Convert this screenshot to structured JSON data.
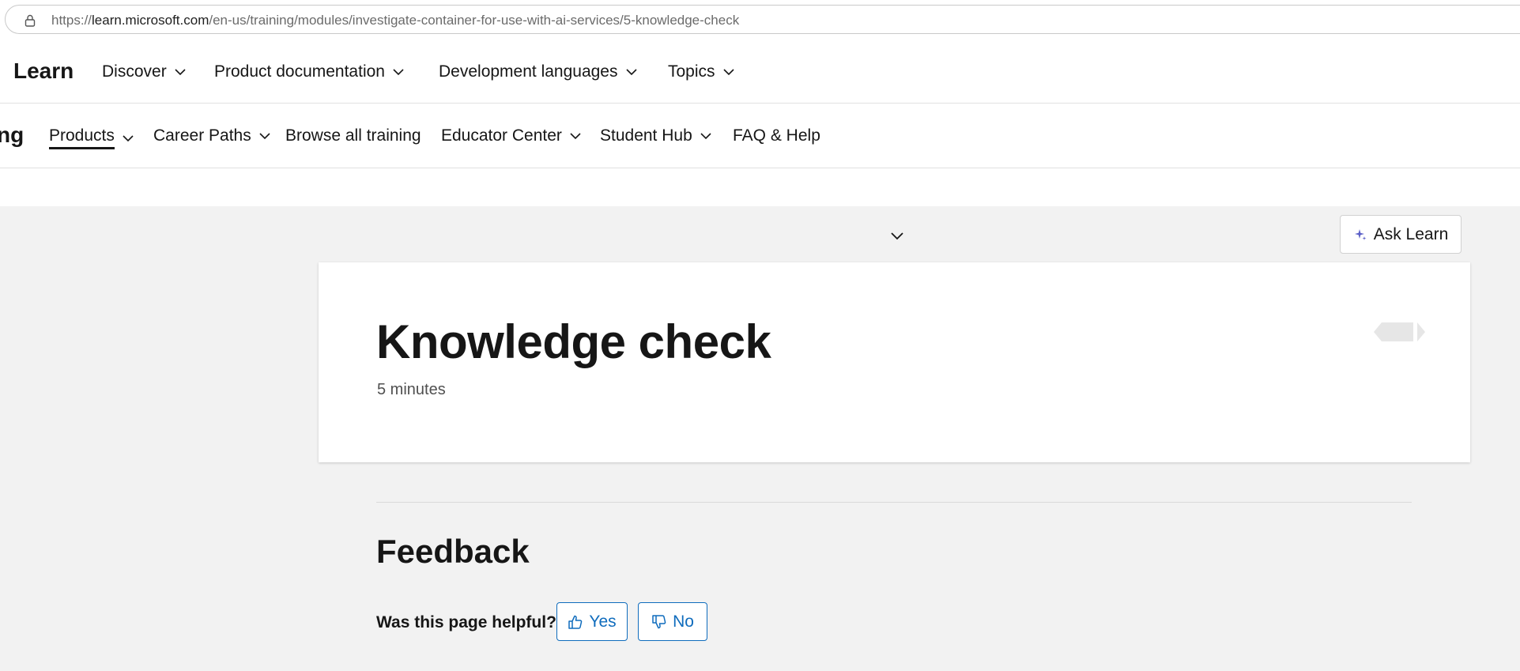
{
  "browser": {
    "url_prefix": "https://",
    "url_host": "learn.microsoft.com",
    "url_path": "/en-us/training/modules/investigate-container-for-use-with-ai-services/5-knowledge-check"
  },
  "global_nav": {
    "brand": "Learn",
    "items": [
      {
        "label": "Discover"
      },
      {
        "label": "Product documentation"
      },
      {
        "label": "Development languages"
      },
      {
        "label": "Topics"
      }
    ]
  },
  "sub_nav": {
    "title_fragment": "ng",
    "items": [
      {
        "label": "Products",
        "active": true
      },
      {
        "label": "Career Paths"
      },
      {
        "label": "Browse all training"
      },
      {
        "label": "Educator Center"
      },
      {
        "label": "Student Hub"
      },
      {
        "label": "FAQ & Help"
      }
    ]
  },
  "toolbar": {
    "ask_learn_label": "Ask Learn"
  },
  "unit": {
    "title": "Knowledge check",
    "duration": "5 minutes"
  },
  "feedback": {
    "title": "Feedback",
    "question": "Was this page helpful?",
    "yes_label": "Yes",
    "no_label": "No"
  },
  "colors": {
    "accent": "#0f6cbd",
    "sparkle": "#5b5fc7",
    "page_bg": "#f2f2f2"
  }
}
